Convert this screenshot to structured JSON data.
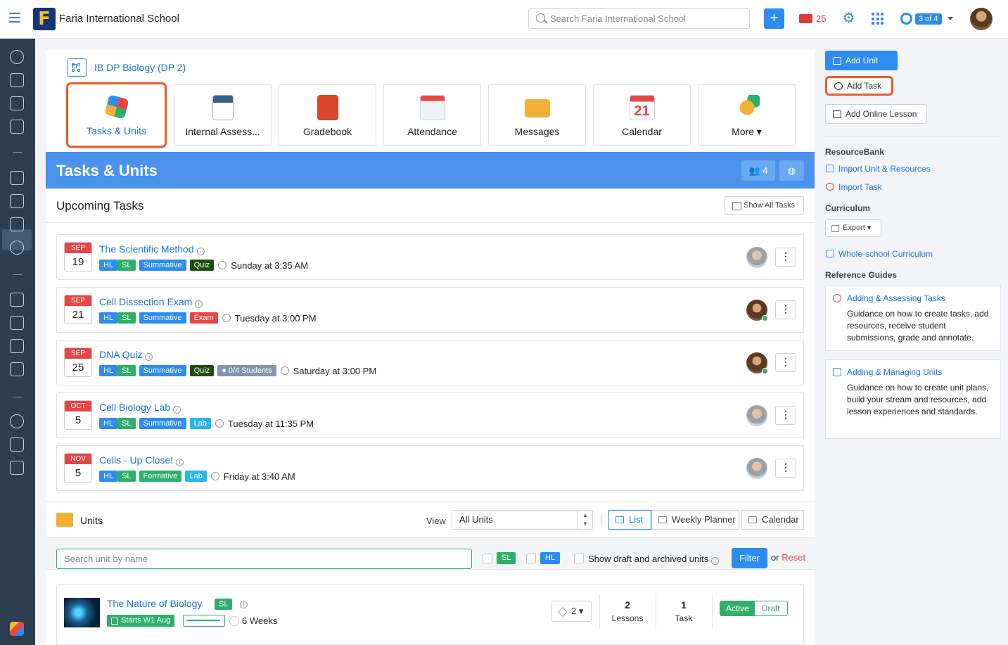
{
  "header": {
    "school_name": "Faria International School",
    "search_placeholder": "Search Faria International School",
    "mail_count": "25",
    "account_badge": "3 of 4"
  },
  "course": {
    "title": "IB DP Biology (DP 2)",
    "tiles": [
      {
        "label": "Tasks & Units",
        "active": true
      },
      {
        "label": "Internal Assess..."
      },
      {
        "label": "Gradebook"
      },
      {
        "label": "Attendance"
      },
      {
        "label": "Messages"
      },
      {
        "label": "Calendar"
      },
      {
        "label": "More"
      }
    ]
  },
  "banner": {
    "title": "Tasks & Units",
    "students_count": "4"
  },
  "upcoming": {
    "heading": "Upcoming Tasks",
    "show_all_label": "Show All Tasks",
    "tasks": [
      {
        "month": "SEP",
        "day": "19",
        "name": "The Scientific Method",
        "tags": [
          "HL",
          "SL",
          "Summative",
          "Quiz"
        ],
        "when": "Sunday at 3:35 AM"
      },
      {
        "month": "SEP",
        "day": "21",
        "name": "Cell Dissection Exam",
        "tags": [
          "HL",
          "SL",
          "Summative",
          "Exam"
        ],
        "when": "Tuesday at 3:00 PM"
      },
      {
        "month": "SEP",
        "day": "25",
        "name": "DNA Quiz",
        "tags": [
          "HL",
          "SL",
          "Summative",
          "Quiz"
        ],
        "students": "0/4 Students",
        "when": "Saturday at 3:00 PM"
      },
      {
        "month": "OCT",
        "day": "5",
        "name": "Cell Biology Lab",
        "tags": [
          "HL",
          "SL",
          "Summative",
          "Lab"
        ],
        "when": "Tuesday at 11:35 PM"
      },
      {
        "month": "NOV",
        "day": "5",
        "name": "Cells - Up Close!",
        "tags": [
          "HL",
          "SL",
          "Formative",
          "Lab"
        ],
        "when": "Friday at 3:40 AM"
      }
    ]
  },
  "units": {
    "heading": "Units",
    "view_label": "View",
    "view_selected": "All Units",
    "view_buttons": [
      "List",
      "Weekly Planner",
      "Calendar"
    ],
    "search_placeholder": "Search unit by name",
    "sl_label": "SL",
    "hl_label": "HL",
    "show_draft_label": "Show draft and archived units",
    "filter_label": "Filter",
    "or_label": "or",
    "reset_label": "Reset",
    "items": [
      {
        "name": "The Nature of Biology",
        "level": "SL",
        "starts": "Starts W1 Aug",
        "duration": "6 Weeks",
        "stack_count": "2",
        "lessons_count": "2",
        "lessons_label": "Lessons",
        "tasks_count": "1",
        "tasks_label": "Task",
        "status_active": "Active",
        "status_draft": "Draft"
      }
    ]
  },
  "right_panel": {
    "add_unit": "Add Unit",
    "add_task": "Add Task",
    "add_online_lesson": "Add Online Lesson",
    "resourcebank_heading": "ResourceBank",
    "import_unit": "Import Unit & Resources",
    "import_task": "Import Task",
    "curriculum_heading": "Curriculum",
    "export_label": "Export",
    "whole_school": "Whole-school Curriculum",
    "reference_heading": "Reference Guides",
    "guides": [
      {
        "title": "Adding & Assessing Tasks",
        "desc": "Guidance on how to create tasks, add resources, receive student submissions, grade and annotate."
      },
      {
        "title": "Adding & Managing Units",
        "desc": "Guidance on how to create unit plans, build your stream and resources, add lesson experiences and standards."
      }
    ]
  },
  "colors": {
    "accent": "#2d8cf0",
    "highlight": "#f05a28",
    "sidebar": "#2c3e50",
    "green": "#2eb06a",
    "red": "#e84545"
  }
}
